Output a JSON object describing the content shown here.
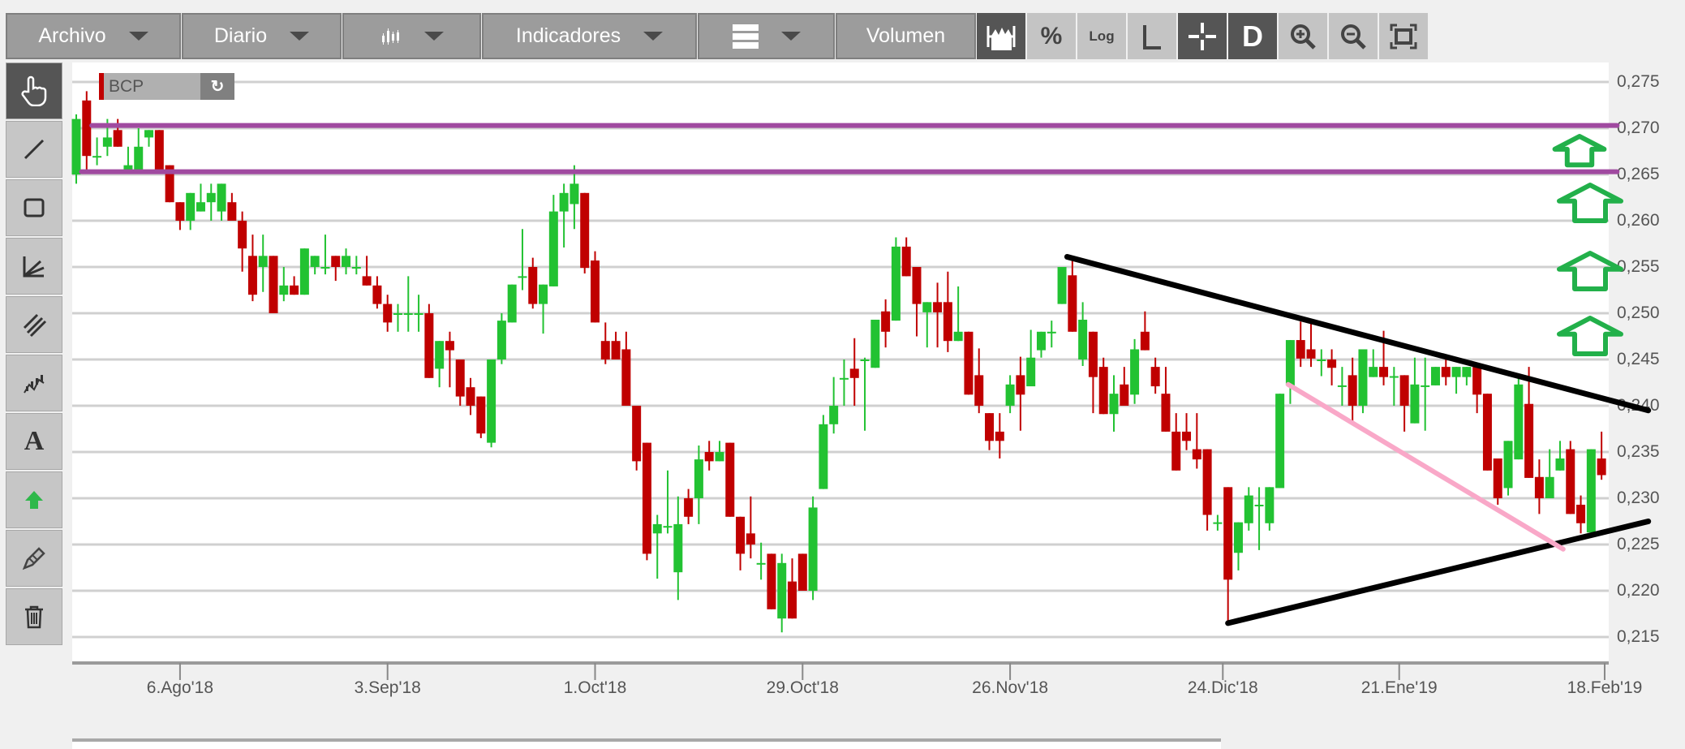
{
  "toolbar": {
    "menus": [
      {
        "label": "Archivo"
      },
      {
        "label": "Diario"
      },
      {
        "icon": "candlestick-chart-icon"
      },
      {
        "label": "Indicadores"
      },
      {
        "icon": "layout-rows-icon"
      },
      {
        "label": "Volumen"
      }
    ],
    "tools": [
      {
        "icon": "volume-profile-icon",
        "active": true
      },
      {
        "label": "%",
        "icon": "percent-icon"
      },
      {
        "label": "Log",
        "icon": "log-scale-icon"
      },
      {
        "label": "L",
        "icon": "axis-icon"
      },
      {
        "icon": "crosshair-icon",
        "active": true
      },
      {
        "label": "D",
        "icon": "d-mode-icon",
        "active": true
      },
      {
        "icon": "zoom-in-icon"
      },
      {
        "icon": "zoom-out-icon"
      },
      {
        "icon": "fit-screen-icon"
      }
    ]
  },
  "sidebar": {
    "tools": [
      "hand-pointer-icon",
      "line-icon",
      "rectangle-icon",
      "angle-icon",
      "parallel-lines-icon",
      "pattern-icon",
      "text-icon",
      "arrow-up-icon",
      "pencil-eraser-icon",
      "trash-icon"
    ],
    "text_tool_label": "A"
  },
  "symbol": {
    "name": "BCP",
    "refresh_icon": "refresh-icon"
  },
  "colors": {
    "up": "#22c232",
    "down": "#c00000",
    "level": "#a04aa0",
    "trend": "#000000",
    "channel": "#f9a8c8",
    "arrow": "#22b04a"
  },
  "chart_data": {
    "type": "candlestick",
    "ylim": [
      0.21,
      0.278
    ],
    "y_ticks": [
      0.275,
      0.27,
      0.265,
      0.26,
      0.255,
      0.25,
      0.245,
      0.24,
      0.235,
      0.23,
      0.225,
      0.22,
      0.215
    ],
    "y_tick_labels": [
      "0,275",
      "0,270",
      "0,265",
      "0,260",
      "0,255",
      "0,250",
      "0,245",
      "0,240",
      "0,235",
      "0,230",
      "0,225",
      "0,220",
      "0,215"
    ],
    "x_ticks": [
      {
        "index": 10,
        "label": "6.Ago'18"
      },
      {
        "index": 30,
        "label": "3.Sep'18"
      },
      {
        "index": 50,
        "label": "1.Oct'18"
      },
      {
        "index": 70,
        "label": "29.Oct'18"
      },
      {
        "index": 90,
        "label": "26.Nov'18"
      },
      {
        "index": 110.5,
        "label": "24.Dic'18"
      },
      {
        "index": 127.5,
        "label": "21.Ene'19"
      },
      {
        "index": 147.3,
        "label": "18.Feb'19"
      }
    ],
    "ohlc": [
      [
        0.265,
        0.2715,
        0.264,
        0.271
      ],
      [
        0.273,
        0.274,
        0.2655,
        0.267
      ],
      [
        0.267,
        0.269,
        0.266,
        0.267
      ],
      [
        0.268,
        0.271,
        0.267,
        0.269
      ],
      [
        0.2698,
        0.271,
        0.268,
        0.268
      ],
      [
        0.2655,
        0.268,
        0.2655,
        0.266
      ],
      [
        0.2655,
        0.27,
        0.2655,
        0.268
      ],
      [
        0.269,
        0.2698,
        0.268,
        0.2698
      ],
      [
        0.2698,
        0.2698,
        0.2655,
        0.2655
      ],
      [
        0.266,
        0.266,
        0.262,
        0.262
      ],
      [
        0.262,
        0.262,
        0.259,
        0.26
      ],
      [
        0.26,
        0.263,
        0.259,
        0.263
      ],
      [
        0.261,
        0.264,
        0.261,
        0.262
      ],
      [
        0.262,
        0.264,
        0.26,
        0.263
      ],
      [
        0.261,
        0.264,
        0.26,
        0.264
      ],
      [
        0.262,
        0.263,
        0.26,
        0.26
      ],
      [
        0.26,
        0.261,
        0.2545,
        0.257
      ],
      [
        0.2562,
        0.2585,
        0.2513,
        0.252
      ],
      [
        0.255,
        0.2585,
        0.2523,
        0.2562
      ],
      [
        0.2562,
        0.2562,
        0.25,
        0.25
      ],
      [
        0.252,
        0.255,
        0.2513,
        0.253
      ],
      [
        0.253,
        0.254,
        0.252,
        0.252
      ],
      [
        0.252,
        0.257,
        0.252,
        0.257
      ],
      [
        0.255,
        0.2562,
        0.2542,
        0.2562
      ],
      [
        0.255,
        0.2585,
        0.2542,
        0.255
      ],
      [
        0.2562,
        0.2562,
        0.2535,
        0.255
      ],
      [
        0.255,
        0.257,
        0.2542,
        0.2562
      ],
      [
        0.255,
        0.2562,
        0.2542,
        0.255
      ],
      [
        0.254,
        0.2562,
        0.253,
        0.253
      ],
      [
        0.253,
        0.254,
        0.2505,
        0.251
      ],
      [
        0.251,
        0.252,
        0.248,
        0.249
      ],
      [
        0.25,
        0.251,
        0.248,
        0.25
      ],
      [
        0.25,
        0.254,
        0.248,
        0.25
      ],
      [
        0.25,
        0.252,
        0.248,
        0.25
      ],
      [
        0.25,
        0.251,
        0.243,
        0.243
      ],
      [
        0.244,
        0.247,
        0.242,
        0.247
      ],
      [
        0.247,
        0.248,
        0.242,
        0.246
      ],
      [
        0.245,
        0.245,
        0.24,
        0.241
      ],
      [
        0.242,
        0.243,
        0.239,
        0.24
      ],
      [
        0.241,
        0.241,
        0.2365,
        0.237
      ],
      [
        0.236,
        0.245,
        0.2355,
        0.245
      ],
      [
        0.245,
        0.25,
        0.2445,
        0.2492
      ],
      [
        0.249,
        0.2531,
        0.249,
        0.2531
      ],
      [
        0.254,
        0.2591,
        0.2525,
        0.254
      ],
      [
        0.255,
        0.256,
        0.2505,
        0.251
      ],
      [
        0.251,
        0.2531,
        0.2478,
        0.2531
      ],
      [
        0.2529,
        0.2628,
        0.2529,
        0.261
      ],
      [
        0.261,
        0.264,
        0.2571,
        0.263
      ],
      [
        0.2618,
        0.266,
        0.2591,
        0.264
      ],
      [
        0.263,
        0.263,
        0.2543,
        0.2549
      ],
      [
        0.2557,
        0.2567,
        0.249,
        0.249
      ],
      [
        0.247,
        0.249,
        0.2445,
        0.245
      ],
      [
        0.247,
        0.248,
        0.245,
        0.245
      ],
      [
        0.2461,
        0.248,
        0.24,
        0.24
      ],
      [
        0.24,
        0.24,
        0.233,
        0.234
      ],
      [
        0.236,
        0.236,
        0.2233,
        0.224
      ],
      [
        0.2262,
        0.2282,
        0.2213,
        0.2272
      ],
      [
        0.227,
        0.233,
        0.2262,
        0.227
      ],
      [
        0.222,
        0.2302,
        0.219,
        0.2272
      ],
      [
        0.23,
        0.231,
        0.2272,
        0.228
      ],
      [
        0.23,
        0.2357,
        0.2272,
        0.2342
      ],
      [
        0.235,
        0.2362,
        0.233,
        0.234
      ],
      [
        0.234,
        0.2362,
        0.234,
        0.235
      ],
      [
        0.236,
        0.236,
        0.228,
        0.228
      ],
      [
        0.228,
        0.228,
        0.2222,
        0.224
      ],
      [
        0.2262,
        0.2302,
        0.2235,
        0.225
      ],
      [
        0.223,
        0.2252,
        0.2212,
        0.223
      ],
      [
        0.224,
        0.224,
        0.218,
        0.218
      ],
      [
        0.217,
        0.224,
        0.2155,
        0.223
      ],
      [
        0.221,
        0.2235,
        0.217,
        0.217
      ],
      [
        0.224,
        0.224,
        0.22,
        0.22
      ],
      [
        0.22,
        0.2302,
        0.219,
        0.229
      ],
      [
        0.231,
        0.239,
        0.231,
        0.238
      ],
      [
        0.238,
        0.2431,
        0.237,
        0.24
      ],
      [
        0.243,
        0.245,
        0.24,
        0.243
      ],
      [
        0.244,
        0.2473,
        0.24,
        0.243
      ],
      [
        0.245,
        0.2452,
        0.2373,
        0.245
      ],
      [
        0.2441,
        0.2493,
        0.2441,
        0.2493
      ],
      [
        0.2502,
        0.2515,
        0.2463,
        0.248
      ],
      [
        0.2492,
        0.2582,
        0.2492,
        0.2572
      ],
      [
        0.2572,
        0.2582,
        0.254,
        0.254
      ],
      [
        0.255,
        0.255,
        0.2475,
        0.251
      ],
      [
        0.2501,
        0.2512,
        0.2463,
        0.2512
      ],
      [
        0.2512,
        0.2533,
        0.2463,
        0.2501
      ],
      [
        0.2512,
        0.2545,
        0.2458,
        0.247
      ],
      [
        0.247,
        0.2529,
        0.247,
        0.248
      ],
      [
        0.248,
        0.248,
        0.2412,
        0.2412
      ],
      [
        0.2433,
        0.2462,
        0.2392,
        0.24
      ],
      [
        0.2392,
        0.2392,
        0.2352,
        0.2362
      ],
      [
        0.2372,
        0.2392,
        0.2343,
        0.2362
      ],
      [
        0.24,
        0.2433,
        0.2392,
        0.2423
      ],
      [
        0.2433,
        0.2453,
        0.2373,
        0.2412
      ],
      [
        0.2421,
        0.2482,
        0.2421,
        0.2452
      ],
      [
        0.246,
        0.248,
        0.2452,
        0.248
      ],
      [
        0.248,
        0.2492,
        0.2463,
        0.248
      ],
      [
        0.251,
        0.255,
        0.251,
        0.255
      ],
      [
        0.2541,
        0.2562,
        0.248,
        0.248
      ],
      [
        0.245,
        0.2512,
        0.2443,
        0.2493
      ],
      [
        0.248,
        0.248,
        0.2392,
        0.2431
      ],
      [
        0.2442,
        0.2452,
        0.2391,
        0.2391
      ],
      [
        0.2391,
        0.2433,
        0.2372,
        0.2413
      ],
      [
        0.2423,
        0.2442,
        0.24,
        0.24
      ],
      [
        0.2412,
        0.2472,
        0.2402,
        0.2461
      ],
      [
        0.248,
        0.2502,
        0.246,
        0.246
      ],
      [
        0.2442,
        0.2452,
        0.2413,
        0.2421
      ],
      [
        0.2413,
        0.2442,
        0.2372,
        0.2372
      ],
      [
        0.2372,
        0.2392,
        0.233,
        0.233
      ],
      [
        0.2372,
        0.2392,
        0.2352,
        0.2362
      ],
      [
        0.2353,
        0.2392,
        0.2332,
        0.2342
      ],
      [
        0.2353,
        0.2353,
        0.2265,
        0.2282
      ],
      [
        0.2274,
        0.2282,
        0.2265,
        0.2274
      ],
      [
        0.2312,
        0.2312,
        0.2163,
        0.2212
      ],
      [
        0.2241,
        0.2274,
        0.2222,
        0.2274
      ],
      [
        0.2273,
        0.2312,
        0.2265,
        0.2303
      ],
      [
        0.2293,
        0.2312,
        0.2244,
        0.2293
      ],
      [
        0.2273,
        0.2312,
        0.2265,
        0.2312
      ],
      [
        0.2311,
        0.2413,
        0.2311,
        0.2413
      ],
      [
        0.2422,
        0.2471,
        0.2402,
        0.2471
      ],
      [
        0.2471,
        0.2491,
        0.2442,
        0.2451
      ],
      [
        0.2461,
        0.2491,
        0.2442,
        0.2451
      ],
      [
        0.245,
        0.2461,
        0.2432,
        0.245
      ],
      [
        0.245,
        0.2461,
        0.2422,
        0.2441
      ],
      [
        0.2422,
        0.2442,
        0.24,
        0.2422
      ],
      [
        0.2433,
        0.2452,
        0.2383,
        0.24
      ],
      [
        0.24,
        0.2461,
        0.2392,
        0.2461
      ],
      [
        0.2431,
        0.2461,
        0.2431,
        0.2442
      ],
      [
        0.2442,
        0.2481,
        0.2422,
        0.2431
      ],
      [
        0.2432,
        0.2442,
        0.24,
        0.2432
      ],
      [
        0.2433,
        0.2433,
        0.2372,
        0.24
      ],
      [
        0.2381,
        0.2452,
        0.2381,
        0.2423
      ],
      [
        0.2422,
        0.2452,
        0.2373,
        0.2422
      ],
      [
        0.2422,
        0.2442,
        0.2422,
        0.2442
      ],
      [
        0.2442,
        0.2452,
        0.2422,
        0.2431
      ],
      [
        0.2431,
        0.2442,
        0.2413,
        0.2442
      ],
      [
        0.2431,
        0.2442,
        0.2422,
        0.2442
      ],
      [
        0.2442,
        0.2442,
        0.2392,
        0.2412
      ],
      [
        0.2413,
        0.2413,
        0.233,
        0.233
      ],
      [
        0.2343,
        0.2343,
        0.2293,
        0.23
      ],
      [
        0.2311,
        0.2362,
        0.2303,
        0.2362
      ],
      [
        0.2342,
        0.2433,
        0.2342,
        0.2423
      ],
      [
        0.2402,
        0.2442,
        0.2322,
        0.2322
      ],
      [
        0.2323,
        0.2342,
        0.2283,
        0.23
      ],
      [
        0.23,
        0.2353,
        0.23,
        0.2323
      ],
      [
        0.233,
        0.2362,
        0.233,
        0.2343
      ],
      [
        0.2353,
        0.2362,
        0.2283,
        0.2283
      ],
      [
        0.2293,
        0.2303,
        0.2262,
        0.2273
      ],
      [
        0.2263,
        0.2353,
        0.2263,
        0.2353
      ],
      [
        0.2343,
        0.2372,
        0.232,
        0.2325
      ]
    ],
    "drawings": [
      {
        "kind": "level",
        "from_index": 1.5,
        "to_index": 148.5,
        "price": 0.2703,
        "color": "level"
      },
      {
        "kind": "level",
        "from_index": 0.5,
        "to_index": 148.5,
        "price": 0.2653,
        "color": "level"
      },
      {
        "kind": "trend",
        "from": [
          95.5,
          0.2561
        ],
        "to": [
          151.5,
          0.2395
        ],
        "color": "trend"
      },
      {
        "kind": "trend",
        "from": [
          111,
          0.2165
        ],
        "to": [
          151.5,
          0.2275
        ],
        "color": "trend"
      },
      {
        "kind": "trend",
        "from": [
          116.8,
          0.2423
        ],
        "to": [
          143.3,
          0.2245
        ],
        "color": "channel"
      }
    ]
  },
  "navigator": {}
}
